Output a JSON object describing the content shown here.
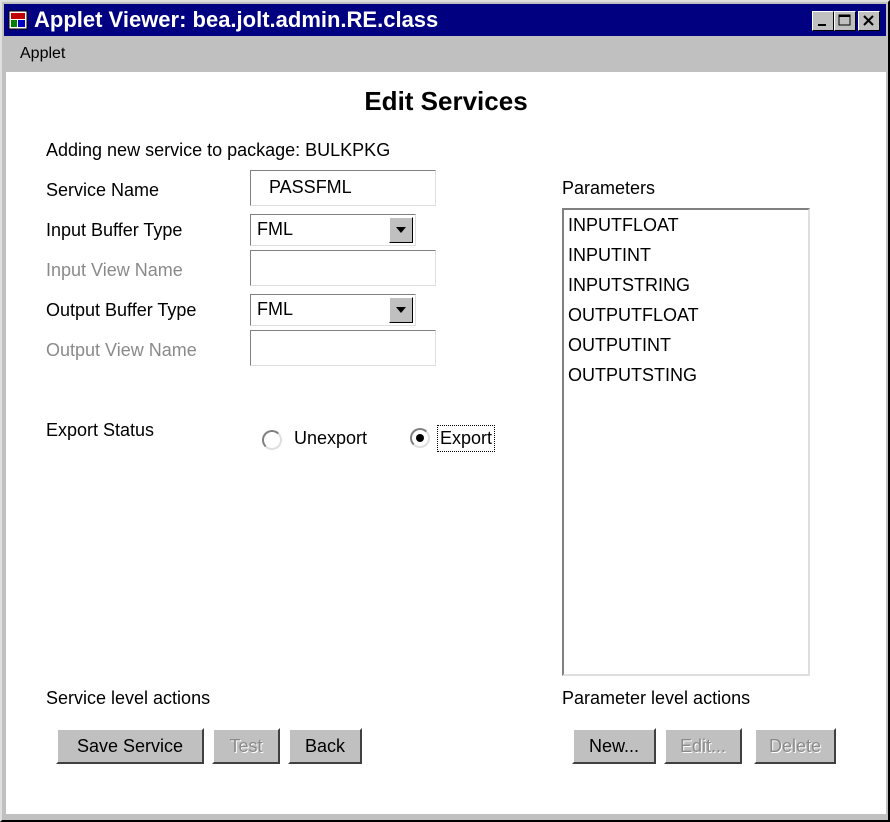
{
  "window": {
    "title": "Applet Viewer: bea.jolt.admin.RE.class",
    "menu": [
      "Applet"
    ]
  },
  "page": {
    "heading": "Edit Services",
    "subtitle": "Adding new service to package: BULKPKG"
  },
  "form": {
    "service_name_label": "Service Name",
    "service_name_value": "PASSFML",
    "input_buffer_label": "Input Buffer Type",
    "input_buffer_value": "FML",
    "input_view_label": "Input View Name",
    "input_view_value": "",
    "output_buffer_label": "Output Buffer Type",
    "output_buffer_value": "FML",
    "output_view_label": "Output View Name",
    "output_view_value": "",
    "export_status_label": "Export Status",
    "radio_unexport_label": "Unexport",
    "radio_export_label": "Export",
    "selected_export": "Export"
  },
  "parameters": {
    "label": "Parameters",
    "items": [
      "INPUTFLOAT",
      "INPUTINT",
      "INPUTSTRING",
      "OUTPUTFLOAT",
      "OUTPUTINT",
      "OUTPUTSTING"
    ]
  },
  "service_actions": {
    "label": "Service level actions",
    "save": "Save Service",
    "test": "Test",
    "back": "Back"
  },
  "parameter_actions": {
    "label": "Parameter level actions",
    "new": "New...",
    "edit": "Edit...",
    "delete": "Delete"
  },
  "colors": {
    "titlebar": "#000080",
    "face": "#c0c0c0",
    "disabled_text": "#8a8a8a"
  }
}
